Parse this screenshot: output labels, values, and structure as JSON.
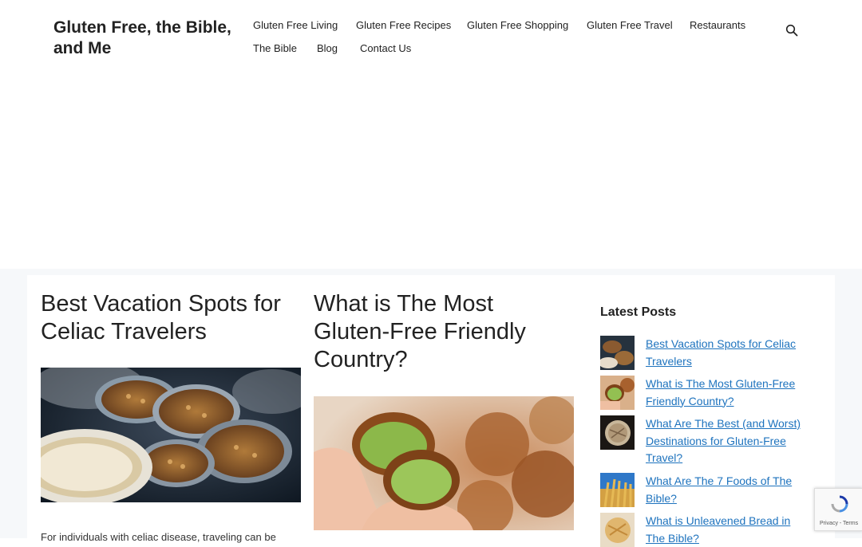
{
  "site": {
    "title": "Gluten Free, the Bible, and Me"
  },
  "nav": {
    "items": [
      "Gluten Free Living",
      "Gluten Free Recipes",
      "Gluten Free Shopping",
      "Gluten Free Travel",
      "Restaurants",
      "The Bible",
      "Blog",
      "Contact Us"
    ]
  },
  "posts": [
    {
      "title": "Best Vacation Spots for Celiac Travelers",
      "excerpt": "For individuals with celiac disease, traveling can be"
    },
    {
      "title": "What is The Most Gluten-Free Friendly Country?"
    }
  ],
  "sidebar": {
    "widget_title": "Latest Posts",
    "items": [
      "Best Vacation Spots for Celiac Travelers",
      "What is The Most Gluten-Free Friendly Country?",
      "What Are The Best (and Worst) Destinations for Gluten-Free Travel?",
      "What Are The 7 Foods of The Bible?",
      "What is Unleavened Bread in The Bible?"
    ]
  },
  "recaptcha": {
    "text": "Privacy - Terms"
  },
  "colors": {
    "link": "#1e73be",
    "content_bg": "#f6f8fa"
  }
}
